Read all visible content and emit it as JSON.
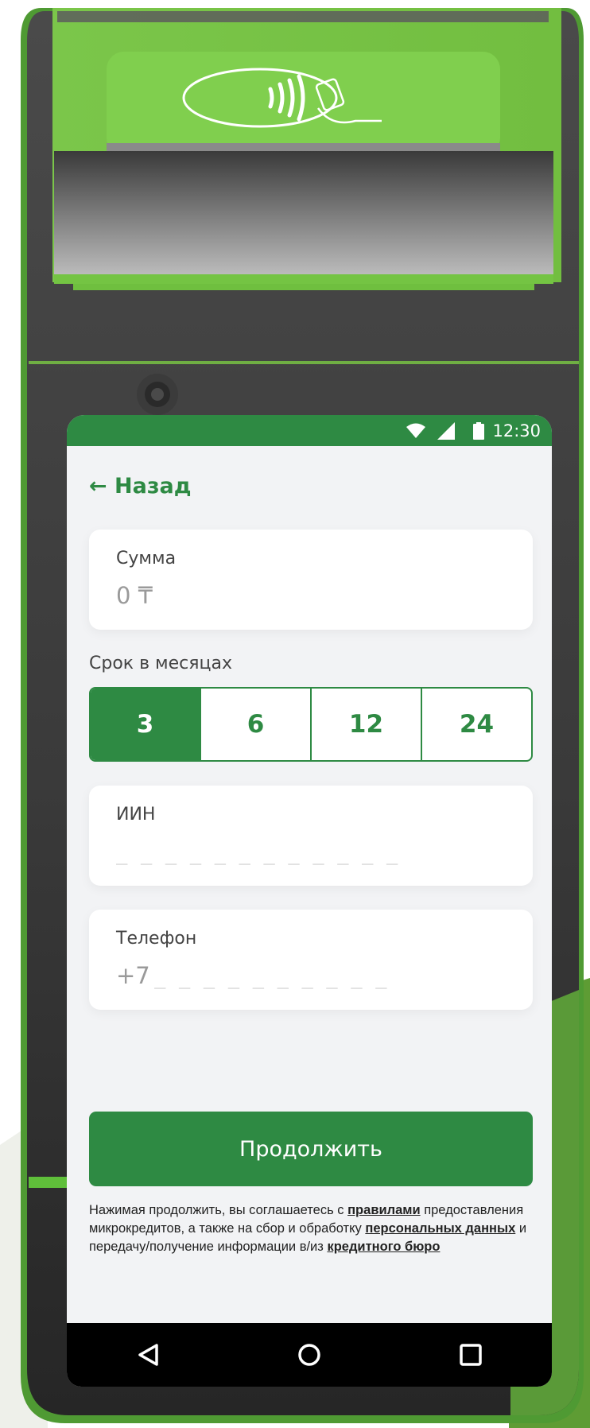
{
  "status_bar": {
    "time": "12:30",
    "wifi_icon": "wifi-icon",
    "signal_icon": "signal-icon",
    "battery_icon": "battery-icon"
  },
  "back": {
    "label": "← Назад"
  },
  "amount": {
    "label": "Сумма",
    "value": "0 ₸"
  },
  "term": {
    "label": "Срок в месяцах",
    "options": [
      "3",
      "6",
      "12",
      "24"
    ],
    "selected": "3"
  },
  "iin": {
    "label": "ИИН",
    "placeholder": "_ _ _ _ _ _ _ _ _ _ _ _"
  },
  "phone": {
    "label": "Телефон",
    "prefix": "+7",
    "placeholder": "_ _ _ _ _ _ _ _ _ _"
  },
  "continue_button": {
    "label": "Продолжить"
  },
  "legal": {
    "part1": "Нажимая продолжить, вы соглашаетесь с ",
    "link1": "правилами",
    "part2": " предоставления микрокредитов, а также на сбор и обработку ",
    "link2": "персональных данных",
    "part3": " и передачу/получение информации в/из ",
    "link3": "кредитного бюро"
  },
  "nav_bar": {
    "back_icon": "triangle-back-icon",
    "home_icon": "circle-home-icon",
    "recents_icon": "square-recents-icon"
  },
  "terminal": {
    "contactless_icon": "contactless-payment-icon"
  },
  "colors": {
    "brand_green": "#2e8a43",
    "device_green": "#7ac943",
    "device_dark": "#3c3c3c"
  }
}
